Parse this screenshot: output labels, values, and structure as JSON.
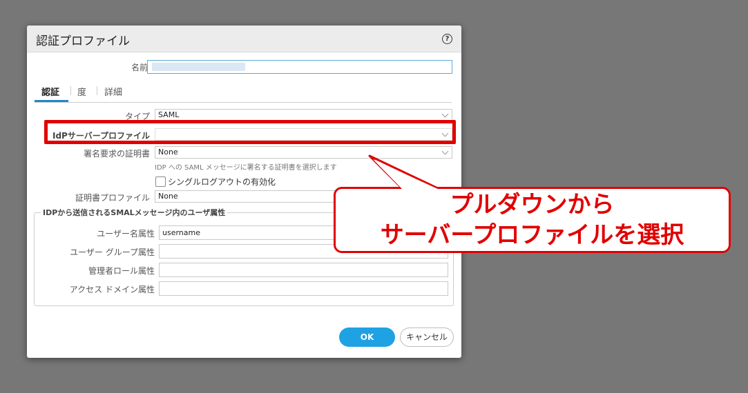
{
  "dialog": {
    "title": "認証プロファイル",
    "help_icon": "question-circle-icon",
    "name_label": "名前",
    "name_value": "",
    "tabs": [
      {
        "label": "認証",
        "active": true
      },
      {
        "label": "度",
        "active": false
      },
      {
        "label": "詳細",
        "active": false
      }
    ],
    "type_label": "タイプ",
    "type_value": "SAML",
    "idp_label": "IdPサーバープロファイル",
    "idp_value": "",
    "sign_cert_label": "署名要求の証明書",
    "sign_cert_value": "None",
    "sign_cert_hint": "IDP への SAML メッセージに署名する証明書を選択します",
    "slo_label": "シングルログアウトの有効化",
    "slo_checked": false,
    "cert_profile_label": "証明書プロファイル",
    "cert_profile_value": "None",
    "attr_section_title": "IDPから送信されるSMALメッセージ内のユーザ属性",
    "username_attr_label": "ユーザー名属性",
    "username_attr_value": "username",
    "group_attr_label": "ユーザー グループ属性",
    "group_attr_value": "",
    "admin_role_attr_label": "管理者ロール属性",
    "admin_role_attr_value": "",
    "access_domain_attr_label": "アクセス ドメイン属性",
    "access_domain_attr_value": "",
    "ok_label": "OK",
    "cancel_label": "キャンセル"
  },
  "annotation": {
    "line1": "プルダウンから",
    "line2": "サーバープロファイルを選択",
    "color": "#e00000"
  },
  "colors": {
    "accent": "#1fa2e3",
    "background": "#777777"
  }
}
